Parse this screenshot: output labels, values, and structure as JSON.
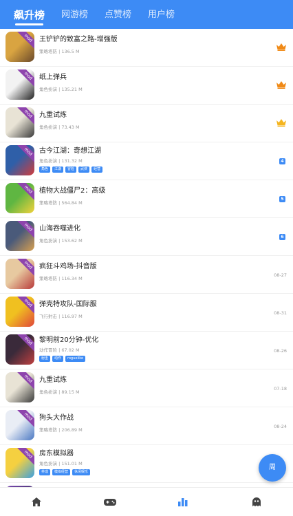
{
  "tabs": [
    {
      "label": "飙升榜",
      "active": true
    },
    {
      "label": "网游榜",
      "active": false
    },
    {
      "label": "点赞榜",
      "active": false
    },
    {
      "label": "用户榜",
      "active": false
    }
  ],
  "colors": {
    "primary": "#3d8bf5",
    "crown_orange": "#f08a17",
    "crown_gold": "#f5b520",
    "mod_badge": "#8e44ad"
  },
  "badge_text": "mod",
  "games": [
    {
      "title": "王铲铲的致富之路-增强版",
      "meta": "策略塔防 | 136.5 M",
      "rank_icon": "crown-orange",
      "tags": []
    },
    {
      "title": "纸上弹兵",
      "meta": "角色扮演 | 135.21 M",
      "rank_icon": "crown-orange",
      "tags": []
    },
    {
      "title": "九重试炼",
      "meta": "角色扮演 | 73.43 M",
      "rank_icon": "crown-gold",
      "tags": []
    },
    {
      "title": "古今江湖：奇想江湖",
      "meta": "角色扮演 | 131.32 M",
      "rank": "4",
      "tags": [
        "角色",
        "江湖",
        "冒险",
        "武侠",
        "经营"
      ]
    },
    {
      "title": "植物大战僵尸2：高级",
      "meta": "策略塔防 | 564.84 M",
      "rank": "5",
      "tags": []
    },
    {
      "title": "山海吞噬进化",
      "meta": "角色扮演 | 153.62 M",
      "rank": "6",
      "tags": []
    },
    {
      "title": "疯狂斗鸡场-抖音版",
      "meta": "策略塔防 | 116.34 M",
      "date": "08-27",
      "tags": []
    },
    {
      "title": "弹壳特攻队-国际服",
      "meta": "飞行射击 | 116.97 M",
      "date": "08-31",
      "tags": []
    },
    {
      "title": "黎明前20分钟-优化",
      "meta": "动作冒险 | 67.02 M",
      "date": "08-26",
      "tags": [
        "射击",
        "动作",
        "roguelike"
      ]
    },
    {
      "title": "九重试炼",
      "meta": "角色扮演 | 89.15 M",
      "date": "07-18",
      "tags": []
    },
    {
      "title": "狗头大作战",
      "meta": "策略塔防 | 206.89 M",
      "date": "08-24",
      "tags": []
    },
    {
      "title": "房东模拟器",
      "meta": "角色扮演 | 151.01 M",
      "date": "",
      "tags": [
        "养成",
        "模拟经营",
        "休闲娱乐"
      ]
    }
  ],
  "fab_label": "周",
  "bottom_nav": [
    {
      "icon": "home-icon"
    },
    {
      "icon": "gamepad-icon"
    },
    {
      "icon": "ranking-icon",
      "active": true
    },
    {
      "icon": "ghost-icon"
    }
  ]
}
